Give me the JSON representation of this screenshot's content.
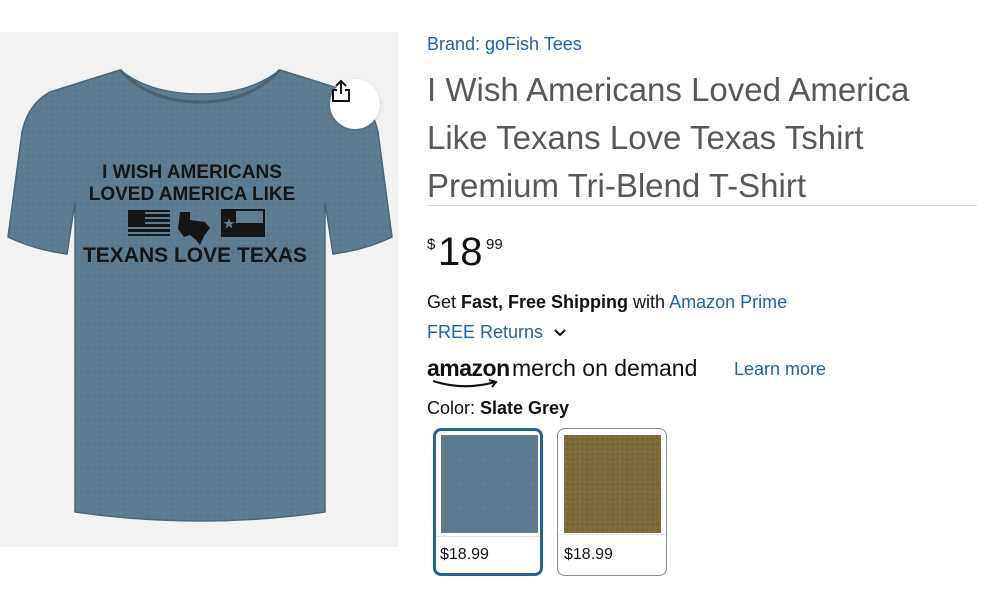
{
  "product": {
    "brand_label": "Brand: goFish Tees",
    "title": "I Wish Americans Loved America Like Texans Love Texas Tshirt Premium Tri-Blend T-Shirt",
    "image_text": {
      "line1": "I WISH AMERICANS",
      "line2": "LOVED AMERICA LIKE",
      "line3": "TEXANS LOVE TEXAS",
      "trademark": "®"
    }
  },
  "price": {
    "symbol": "$",
    "whole": "18",
    "fraction": "99"
  },
  "shipping": {
    "prefix": "Get ",
    "bold": "Fast, Free Shipping",
    "middle": " with ",
    "link": "Amazon Prime"
  },
  "returns": {
    "label": "FREE Returns"
  },
  "merch": {
    "logo": "amazon",
    "text": "merch on demand",
    "learn_more": "Learn more"
  },
  "color": {
    "label": "Color: ",
    "selected": "Slate Grey",
    "swatches": [
      {
        "price": "$18.99",
        "color_hex": "#5f7b8f",
        "selected": true
      },
      {
        "price": "$18.99",
        "color_hex": "#7a6a3c",
        "selected": false
      }
    ]
  },
  "icons": {
    "share": "share-icon",
    "chevron": "chevron-down-icon"
  },
  "colors": {
    "link": "#2162a1",
    "title": "#565959",
    "shirt": "#5f7b8f"
  }
}
